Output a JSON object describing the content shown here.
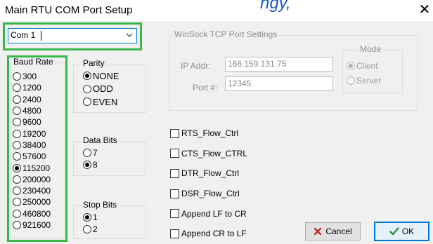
{
  "window": {
    "title": "Main RTU COM Port Setup",
    "title_partial": "ngy,",
    "close_glyph": "✕"
  },
  "com_port": {
    "value": "Com 1",
    "options": [
      "Com 1"
    ]
  },
  "baud_rate": {
    "label": "Baud Rate",
    "selected": "115200",
    "options": [
      "300",
      "1200",
      "2400",
      "4800",
      "9600",
      "19200",
      "38400",
      "57600",
      "115200",
      "200000",
      "230400",
      "250000",
      "460800",
      "921600"
    ]
  },
  "parity": {
    "label": "Parity",
    "selected": "NONE",
    "options": [
      "NONE",
      "ODD",
      "EVEN"
    ]
  },
  "data_bits": {
    "label": "Data Bits",
    "selected": "8",
    "options": [
      "7",
      "8"
    ]
  },
  "stop_bits": {
    "label": "Stop Bits",
    "selected": "1",
    "options": [
      "1",
      "2"
    ]
  },
  "winsock": {
    "label": "WinSock TCP Port Settings",
    "ip_label": "IP Addr:",
    "ip_value": "166.159.131.75",
    "port_label": "Port #:",
    "port_value": "12345",
    "mode": {
      "label": "Mode",
      "selected": "Client",
      "options": [
        "Client",
        "Server"
      ]
    }
  },
  "flow_options": [
    {
      "label": "RTS_Flow_Ctrl",
      "checked": false
    },
    {
      "label": "CTS_Flow_CTRL",
      "checked": false
    },
    {
      "label": "DTR_Flow_Ctrl",
      "checked": false
    },
    {
      "label": "DSR_Flow_Ctrl",
      "checked": false
    },
    {
      "label": "Append LF to CR",
      "checked": false
    },
    {
      "label": "Append CR to LF",
      "checked": false
    }
  ],
  "buttons": {
    "cancel": "Cancel",
    "ok": "OK"
  },
  "colors": {
    "highlight": "#3ab54a",
    "focus": "#0078d7",
    "cancel_icon": "#c42b1c",
    "ok_icon": "#2e8b3a"
  },
  "icons": {
    "close": "close-icon",
    "dropdown": "chevron-down-icon",
    "cancel": "x-mark-icon",
    "ok": "check-mark-icon"
  }
}
